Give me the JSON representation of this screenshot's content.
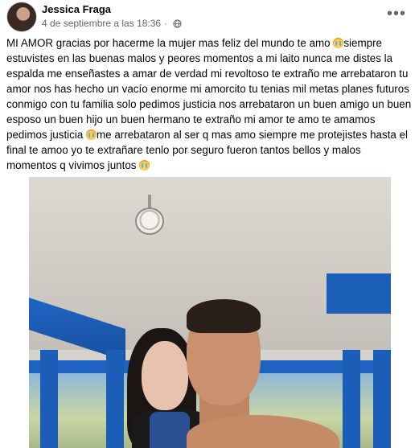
{
  "post": {
    "author": "Jessica Fraga",
    "timestamp": "4 de septiembre a las 18:36",
    "separator": "·",
    "text_parts": [
      "MI AMOR gracias por hacerme la mujer mas feliz del mundo te amo ",
      "siempre estuvistes en las buenas malos y peores momentos a mi laito nunca me distes la espalda me enseñastes a amar de verdad mi revoltoso te extraño me arrebataron tu amor nos has hecho un vacío enorme mi amorcito tu tenias mil metas planes futuros conmigo con tu familia solo pedimos justicia nos arrebataron un buen amigo un buen esposo un buen hijo un buen hermano te extraño mi amor te amo te amamos pedimos justicia ",
      "me arrebataron al ser q mas amo siempre me protejistes hasta el final te amoo yo te extrañare tenlo por seguro fueron tantos bellos y malos momentos q vivimos juntos "
    ],
    "emoji": "crying-face-icon",
    "audience_icon": "globe-icon",
    "more_icon": "more-options-icon"
  },
  "colors": {
    "text": "#050505",
    "meta": "#65676b",
    "pillar_blue": "#1b5db7"
  }
}
